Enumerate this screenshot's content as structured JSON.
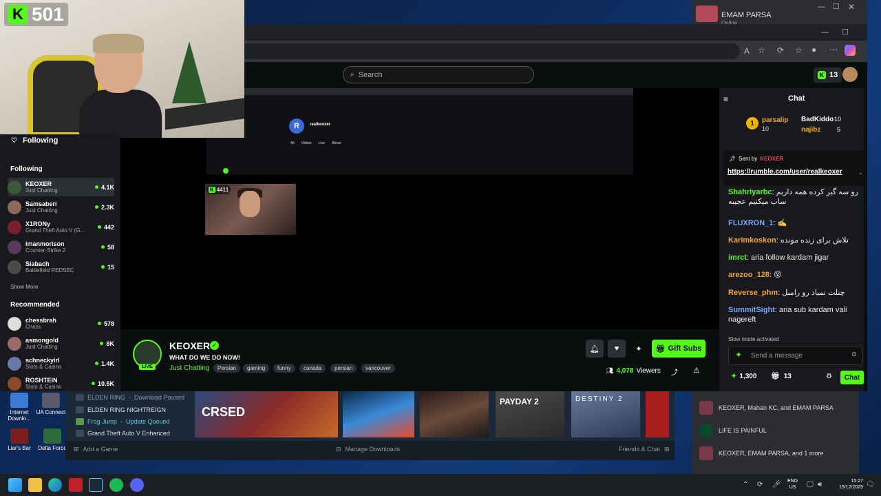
{
  "webcam": {
    "kick_count": "501"
  },
  "discord": {
    "user": "EMAM PARSA",
    "status": "Online"
  },
  "search": {
    "placeholder": "Search"
  },
  "header": {
    "points": "13"
  },
  "sidebar": {
    "following_title": "Following",
    "following_label": "Following",
    "following": [
      {
        "name": "KEOXER",
        "category": "Just Chatting",
        "viewers": "4.1K"
      },
      {
        "name": "Samsaberi",
        "category": "Just Chatting",
        "viewers": "2.3K"
      },
      {
        "name": "X1RONy",
        "category": "Grand Theft Auto V (G...",
        "viewers": "442"
      },
      {
        "name": "imanmorison",
        "category": "Counter-Strike 2",
        "viewers": "58"
      },
      {
        "name": "Siabach",
        "category": "Battlefield REDSEC",
        "viewers": "15"
      }
    ],
    "show_more": "Show More",
    "recommended_label": "Recommended",
    "recommended": [
      {
        "name": "chessbrah",
        "category": "Chess",
        "viewers": "578"
      },
      {
        "name": "asmongold",
        "category": "Just Chatting",
        "viewers": "8K"
      },
      {
        "name": "schneckyirl",
        "category": "Slots & Casino",
        "viewers": "1.4K"
      },
      {
        "name": "ROSHTEIN",
        "category": "Slots & Casino",
        "viewers": "10.5K"
      }
    ]
  },
  "video": {
    "inner_channel": "realkeoxer",
    "inner_tabs": [
      "All",
      "Videos",
      "Live",
      "About"
    ],
    "pip_count": "4411"
  },
  "stream": {
    "channel": "KEOXER",
    "live": "LIVE",
    "title": "WHAT DO WE DO NOW!",
    "category": "Just Chatting",
    "tags": [
      "Persian",
      "gaming",
      "funny",
      "canada",
      "persian",
      "vancouver"
    ],
    "gift_label": "Gift Subs",
    "viewers": "4,078",
    "viewers_label": "Viewers"
  },
  "chat": {
    "title": "Chat",
    "leaderboard": [
      {
        "name": "parsalip",
        "value": "10"
      },
      {
        "name": "BadKiddo",
        "value": "10"
      },
      {
        "name": "najibz",
        "value": "5"
      }
    ],
    "pinned_by_label": "Sent by",
    "pinned_by": "KEOXER",
    "pinned_link": "https://rumble.com/user/realkeoxer",
    "messages": [
      {
        "user": "Shahriyarbc",
        "text": "رو سه گیر کرده همه داریم ساب میکنیم عجیبه",
        "color": "#53fc18"
      },
      {
        "user": "FLUXRON_1",
        "text": "",
        "color": "#7aa7ff"
      },
      {
        "user": "Karimkoskon",
        "text": "تلاش برای زنده مونده",
        "color": "#f5a623"
      },
      {
        "user": "imrct",
        "text": "aria follow kardam jigar",
        "color": "#53fc18"
      },
      {
        "user": "arezoo_128",
        "text": "",
        "color": "#f5a623"
      },
      {
        "user": "Reverse_phm",
        "text": "چنلت نمیاد رو رامبل",
        "color": "#f5a623"
      },
      {
        "user": "SummitSight",
        "text": "aria sub kardam vali nagereft",
        "color": "#7aa7ff"
      }
    ],
    "slow_mode": "Slow mode activated",
    "input_placeholder": "Send a message",
    "points": "1,300",
    "gifts": "13",
    "send": "Chat"
  },
  "steam": {
    "downloads": [
      {
        "name": "ELDEN RING",
        "status": "Download Paused"
      },
      {
        "name": "ELDEN RING NIGHTREIGN",
        "status": ""
      },
      {
        "name": "Frog Jump",
        "status": "Update Queued"
      },
      {
        "name": "Grand Theft Auto V Enhanced",
        "status": ""
      }
    ],
    "add_game": "Add a Game",
    "manage_downloads": "Manage Downloads",
    "friends_chat": "Friends & Chat",
    "shelf": [
      "CRSED",
      "",
      "",
      "",
      "PAYDAY 2",
      "DESTINY 2"
    ]
  },
  "desktop_icons": [
    {
      "label": "Internet Downlo..."
    },
    {
      "label": "UA Connect"
    },
    {
      "label": "Liar's Bar"
    },
    {
      "label": "Delta Force"
    }
  ],
  "notifications": [
    {
      "text": "KEOXER, Mahan KC, and EMAM PARSA"
    },
    {
      "text": "LIFE IS PAINFUL"
    },
    {
      "text": "KEOXER, EMAM PARSA, and 1 more"
    }
  ],
  "taskbar": {
    "lang": "ENG",
    "region": "US",
    "time": "15:27",
    "date": "15/12/2025"
  },
  "colors": {
    "kick_green": "#53fc18"
  }
}
